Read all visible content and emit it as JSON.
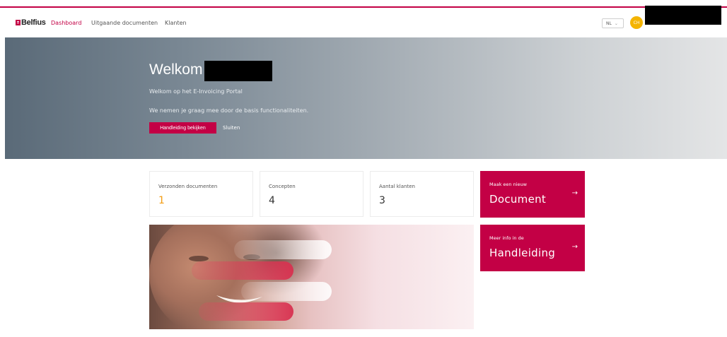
{
  "brand": {
    "logo_text": "Belfius",
    "accent_color": "#c30045"
  },
  "nav": {
    "links": [
      {
        "label": "Dashboard",
        "active": true
      },
      {
        "label": "Uitgaande documenten",
        "active": false
      },
      {
        "label": "Klanten",
        "active": false
      }
    ],
    "language": "NL",
    "avatar_initials": "CH"
  },
  "hero": {
    "title": "Welkom",
    "subtitle": "Welkom op het E-Invoicing Portal",
    "description": "We nemen je graag mee door de basis functionaliteiten.",
    "primary_button": "Handleiding bekijken",
    "secondary_button": "Sluiten"
  },
  "stats": [
    {
      "label": "Verzonden documenten",
      "value": "1"
    },
    {
      "label": "Concepten",
      "value": "4"
    },
    {
      "label": "Aantal klanten",
      "value": "3"
    }
  ],
  "actions": [
    {
      "small": "Maak een nieuw",
      "big": "Document",
      "icon": "arrow-right-icon"
    },
    {
      "small": "Meer info in de",
      "big": "Handleiding",
      "icon": "arrow-right-icon"
    }
  ]
}
